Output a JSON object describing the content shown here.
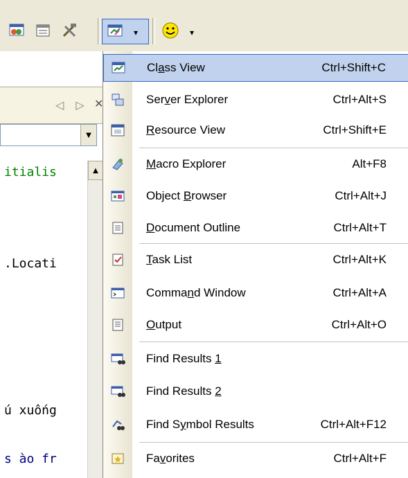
{
  "toolbar": {
    "icons": [
      "chart-icon",
      "properties-icon",
      "tools-icon",
      "class-view-icon",
      "smiley-icon"
    ]
  },
  "tabs": {
    "arrows": "◁ ▷",
    "close": "✕"
  },
  "code_lines": [
    {
      "text": "itialis",
      "color": "#008000"
    },
    {
      "text": ".Locati",
      "color": "#000000"
    },
    {
      "text": "ú xuống",
      "color": "#000000"
    },
    {
      "text": "s ào fr",
      "color": "#000080"
    }
  ],
  "menu": {
    "items": [
      {
        "pre": "Cl",
        "mn": "a",
        "post": "ss View",
        "shortcut": "Ctrl+Shift+C",
        "icon": "class-view-icon",
        "selected": true
      },
      {
        "pre": "Ser",
        "mn": "v",
        "post": "er Explorer",
        "shortcut": "Ctrl+Alt+S",
        "icon": "server-explorer-icon"
      },
      {
        "pre": "",
        "mn": "R",
        "post": "esource View",
        "shortcut": "Ctrl+Shift+E",
        "icon": "resource-view-icon"
      },
      {
        "pre": "",
        "mn": "M",
        "post": "acro Explorer",
        "shortcut": "Alt+F8",
        "icon": "macro-explorer-icon"
      },
      {
        "pre": "Object ",
        "mn": "B",
        "post": "rowser",
        "shortcut": "Ctrl+Alt+J",
        "icon": "object-browser-icon"
      },
      {
        "pre": "",
        "mn": "D",
        "post": "ocument Outline",
        "shortcut": "Ctrl+Alt+T",
        "icon": "document-outline-icon"
      },
      {
        "pre": "",
        "mn": "T",
        "post": "ask List",
        "shortcut": "Ctrl+Alt+K",
        "icon": "task-list-icon"
      },
      {
        "pre": "Comma",
        "mn": "n",
        "post": "d Window",
        "shortcut": "Ctrl+Alt+A",
        "icon": "command-window-icon"
      },
      {
        "pre": "",
        "mn": "O",
        "post": "utput",
        "shortcut": "Ctrl+Alt+O",
        "icon": "output-icon"
      },
      {
        "pre": "Find Results ",
        "mn": "1",
        "post": "",
        "shortcut": "",
        "icon": "find-results-icon"
      },
      {
        "pre": "Find Results ",
        "mn": "2",
        "post": "",
        "shortcut": "",
        "icon": "find-results-icon"
      },
      {
        "pre": "Find S",
        "mn": "y",
        "post": "mbol Results",
        "shortcut": "Ctrl+Alt+F12",
        "icon": "find-symbol-icon"
      },
      {
        "pre": "Fa",
        "mn": "v",
        "post": "orites",
        "shortcut": "Ctrl+Alt+F",
        "icon": "favorites-icon"
      }
    ]
  }
}
